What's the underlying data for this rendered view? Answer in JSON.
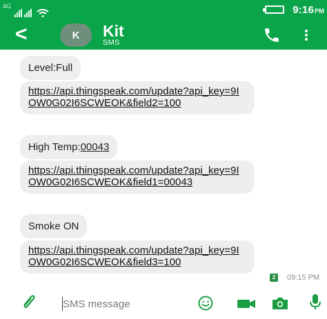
{
  "status_bar": {
    "network_badge": "4G",
    "time": "9:16",
    "ampm": "PM",
    "icons": [
      "signal-icon",
      "signal-icon",
      "wifi-icon",
      "battery-icon"
    ]
  },
  "app_bar": {
    "avatar_letter": "K",
    "contact_name": "Kit",
    "contact_subtitle": "SMS",
    "icons": [
      "back-icon",
      "phone-icon",
      "overflow-menu-icon"
    ]
  },
  "messages": [
    {
      "kind": "text",
      "text": "Level:Full"
    },
    {
      "kind": "link",
      "text": "https://api.thingspeak.com/update?api_key=9IOW0G02I6SCWEOK&field2=100"
    },
    {
      "kind": "text_with_digits",
      "prefix": "High Temp:",
      "digits": "00043"
    },
    {
      "kind": "link",
      "text": "https://api.thingspeak.com/update?api_key=9IOW0G02I6SCWEOK&field1=00043"
    },
    {
      "kind": "text",
      "text": "Smoke ON"
    },
    {
      "kind": "link",
      "text": "https://api.thingspeak.com/update?api_key=9IOW0G02I6SCWEOK&field3=100"
    }
  ],
  "last_message": {
    "sim_badge": "2",
    "timestamp": "09:15 PM"
  },
  "composer": {
    "placeholder": "SMS message",
    "value": "",
    "icons": [
      "attach-icon",
      "emoji-icon",
      "video-icon",
      "camera-icon",
      "mic-icon"
    ]
  },
  "colors": {
    "status_bar": "#0aa54a",
    "app_bar": "#09a548",
    "bubble": "#eeeeee",
    "avatar": "#6f8f7c",
    "sim_badge": "#2b8f4a",
    "icon_green": "#1b9d43"
  }
}
